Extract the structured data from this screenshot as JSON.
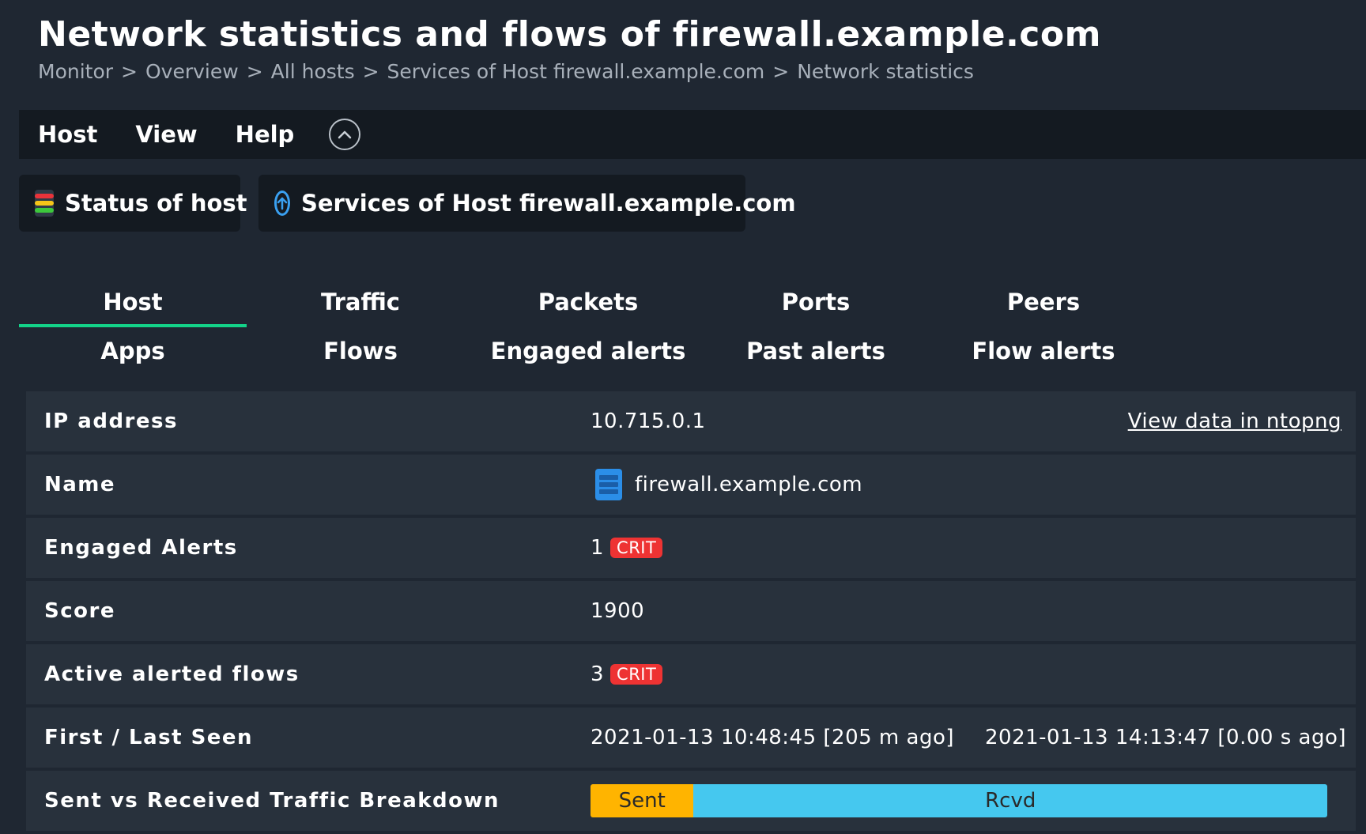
{
  "page": {
    "title": "Network statistics and flows of firewall.example.com",
    "breadcrumb": [
      "Monitor",
      "Overview",
      "All hosts",
      "Services of Host firewall.example.com",
      "Network statistics"
    ],
    "breadcrumb_separator": ">"
  },
  "menubar": {
    "items": [
      "Host",
      "View",
      "Help"
    ],
    "collapse_icon": "chevron-up-icon"
  },
  "actions": {
    "status_label": "Status of host",
    "services_label": "Services of Host firewall.example.com"
  },
  "tabs": {
    "row1": [
      "Host",
      "Traffic",
      "Packets",
      "Ports",
      "Peers"
    ],
    "row2": [
      "Apps",
      "Flows",
      "Engaged alerts",
      "Past alerts",
      "Flow alerts"
    ],
    "active": "Host",
    "active_color": "#13d389"
  },
  "details": {
    "ip_label": "IP address",
    "ip_value": "10.715.0.1",
    "ntopng_link": "View data in ntopng",
    "name_label": "Name",
    "name_value": "firewall.example.com",
    "engaged_label": "Engaged Alerts",
    "engaged_count": "1",
    "engaged_badge": "CRIT",
    "score_label": "Score",
    "score_value": "1900",
    "flows_label": "Active alerted flows",
    "flows_count": "3",
    "flows_badge": "CRIT",
    "seen_label": "First / Last Seen",
    "first_seen": "2021-01-13 10:48:45 [205 m ago]",
    "last_seen": "2021-01-13 14:13:47 [0.00 s ago]",
    "traffic_label": "Sent vs Received Traffic Breakdown",
    "sent_label": "Sent",
    "rcvd_label": "Rcvd",
    "sent_fraction": 0.14
  },
  "colors": {
    "crit": "#ee3333",
    "sent": "#ffb400",
    "rcvd": "#45c8ef",
    "background": "#1f2732"
  }
}
